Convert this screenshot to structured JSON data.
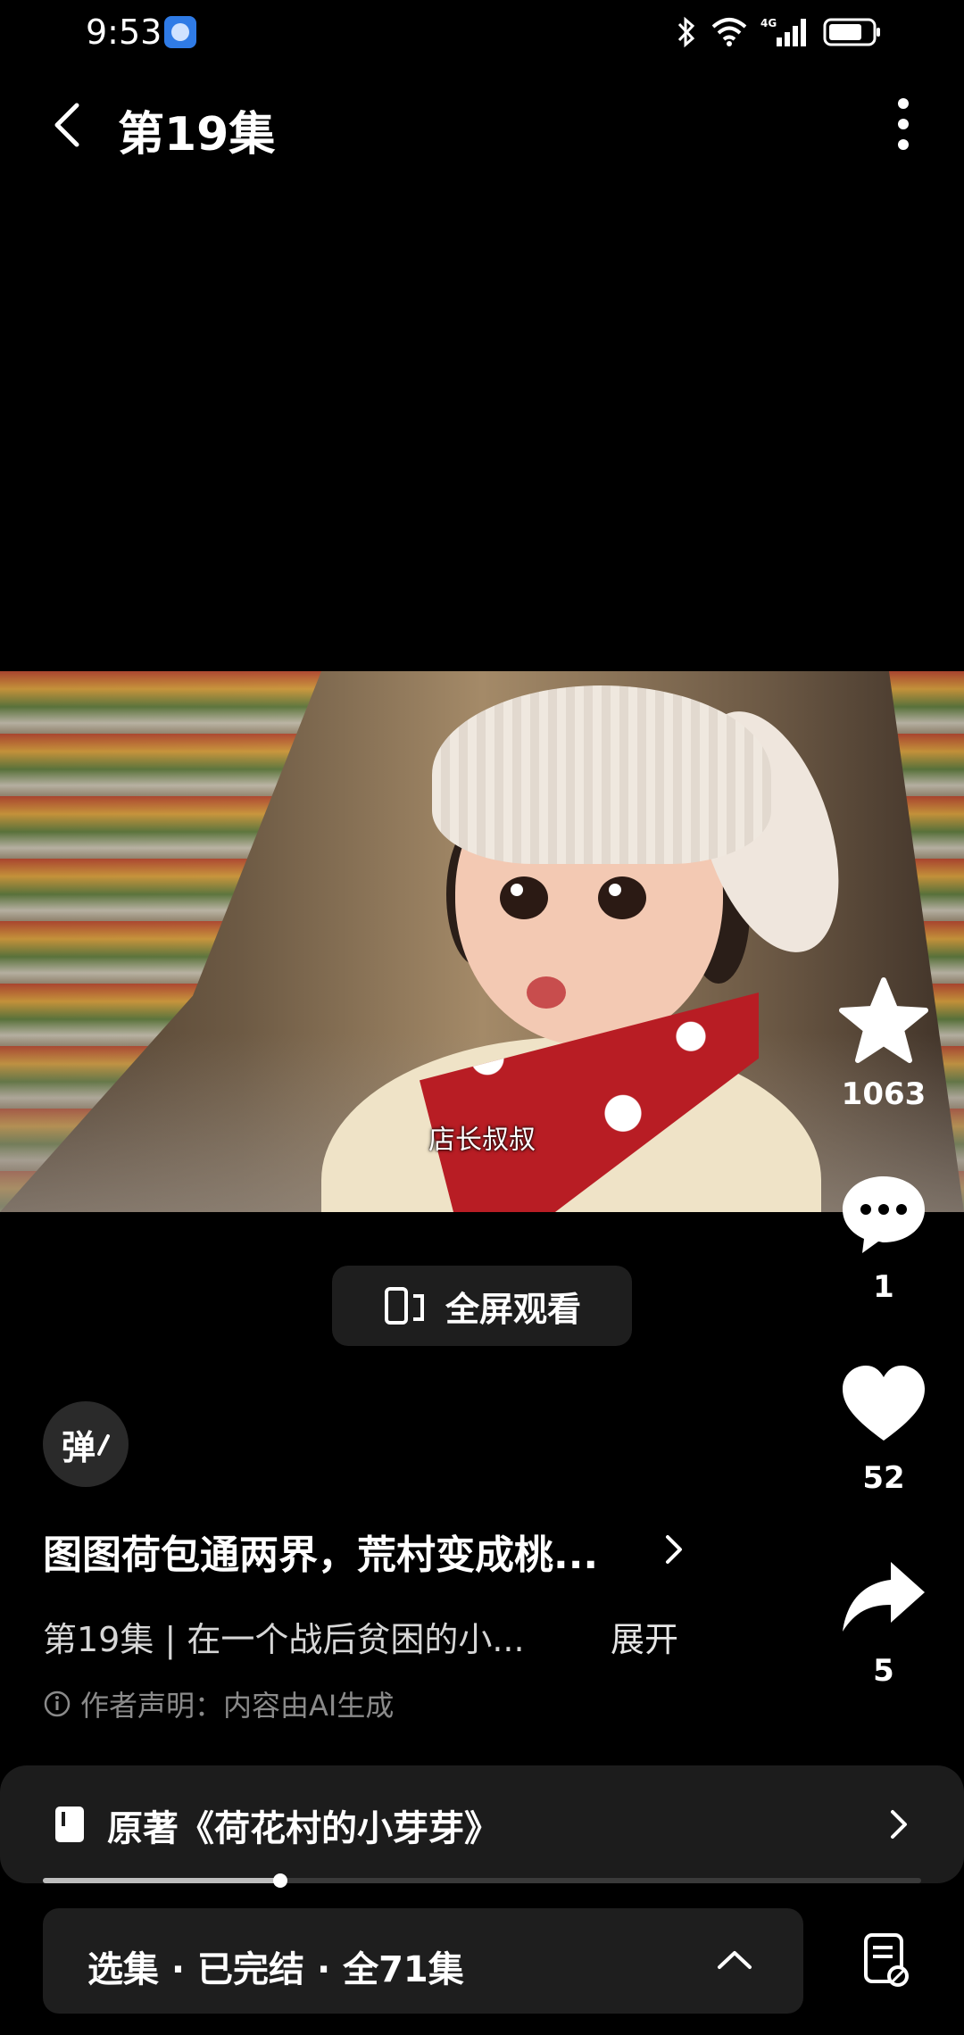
{
  "status_bar": {
    "time": "9:53",
    "network": "4G",
    "icons": [
      "app-icon",
      "bluetooth-icon",
      "wifi-icon",
      "signal-icon",
      "battery-icon"
    ]
  },
  "header": {
    "title": "第19集",
    "icons": [
      "back-icon",
      "more-icon"
    ]
  },
  "video": {
    "subtitle": "店长叔叔"
  },
  "actions": {
    "favorite_count": "1063",
    "comment_count": "1",
    "like_count": "52",
    "share_count": "5"
  },
  "fullscreen_button": "全屏观看",
  "danmaku_button": "弹",
  "info": {
    "drama_title": "图图荷包通两界，荒村变成桃...",
    "episode_desc": "第19集 | 在一个战后贫困的小...",
    "expand_label": "展开",
    "disclaimer": "作者声明：内容由AI生成"
  },
  "novel_bar": {
    "label": "原著《荷花村的小芽芽》"
  },
  "progress": {
    "fraction": 0.27
  },
  "episodes_bar": {
    "label": "选集 · 已完结 · 全71集"
  },
  "colors": {
    "background": "#000000",
    "panel": "#1e1e1e",
    "text_primary": "#ffffff",
    "text_secondary": "#8a8a8a"
  }
}
